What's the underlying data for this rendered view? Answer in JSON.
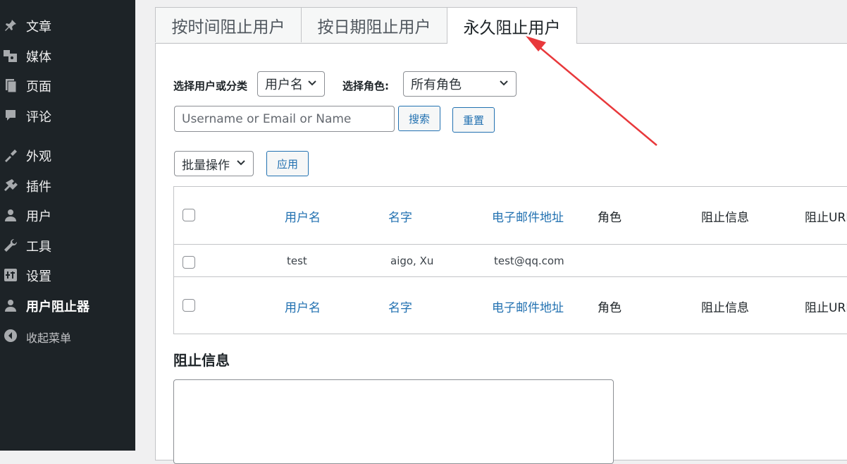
{
  "sidebar": {
    "items": [
      {
        "label": "文章",
        "icon": "pin-icon"
      },
      {
        "label": "媒体",
        "icon": "media-icon"
      },
      {
        "label": "页面",
        "icon": "page-icon"
      },
      {
        "label": "评论",
        "icon": "comment-icon"
      },
      {
        "label": "外观",
        "icon": "appearance-icon"
      },
      {
        "label": "插件",
        "icon": "plugin-icon"
      },
      {
        "label": "用户",
        "icon": "user-icon"
      },
      {
        "label": "工具",
        "icon": "wrench-icon"
      },
      {
        "label": "设置",
        "icon": "settings-icon"
      },
      {
        "label": "用户阻止器",
        "icon": "user-icon"
      }
    ],
    "collapse_label": "收起菜单"
  },
  "tabs": [
    {
      "label": "按时间阻止用户",
      "active": false
    },
    {
      "label": "按日期阻止用户",
      "active": false
    },
    {
      "label": "永久阻止用户",
      "active": true
    }
  ],
  "filters": {
    "select_user_label": "选择用户或分类",
    "user_field_value": "用户名",
    "select_role_label": "选择角色:",
    "role_value": "所有角色",
    "search_placeholder": "Username or Email or Name",
    "search_button": "搜索",
    "reset_button": "重置"
  },
  "bulk": {
    "action_value": "批量操作",
    "apply_button": "应用"
  },
  "table": {
    "columns": [
      "用户名",
      "名字",
      "电子邮件地址",
      "角色",
      "阻止信息",
      "阻止URL"
    ],
    "rows": [
      {
        "username": "test",
        "name": "aigo, Xu",
        "email": "test@qq.com",
        "role": "",
        "block_info": "",
        "block_url": ""
      }
    ]
  },
  "block_message": {
    "heading": "阻止信息"
  },
  "colors": {
    "sidebar_bg": "#1d2327",
    "accent": "#2271b1",
    "annotation_arrow": "#e8383b"
  }
}
